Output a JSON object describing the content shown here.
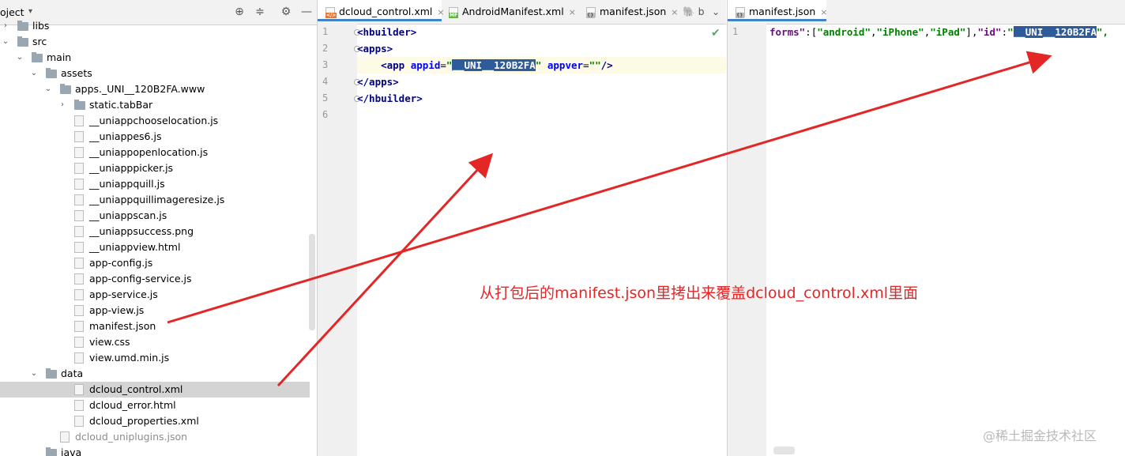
{
  "project": {
    "title": "oject",
    "title_dropdown": "▾",
    "tree": [
      {
        "label": "libs",
        "indent": 1,
        "arrow": "›",
        "kind": "folder"
      },
      {
        "label": "src",
        "indent": 1,
        "arrow": "⌄",
        "kind": "folder"
      },
      {
        "label": "main",
        "indent": 2,
        "arrow": "⌄",
        "kind": "folder"
      },
      {
        "label": "assets",
        "indent": 3,
        "arrow": "⌄",
        "kind": "folder"
      },
      {
        "label": "apps._UNI__120B2FA.www",
        "indent": 4,
        "arrow": "⌄",
        "kind": "folder"
      },
      {
        "label": "static.tabBar",
        "indent": 5,
        "arrow": "›",
        "kind": "folder"
      },
      {
        "label": "__uniappchooselocation.js",
        "indent": 5,
        "kind": "js"
      },
      {
        "label": "__uniappes6.js",
        "indent": 5,
        "kind": "js"
      },
      {
        "label": "__uniappopenlocation.js",
        "indent": 5,
        "kind": "js"
      },
      {
        "label": "__uniapppicker.js",
        "indent": 5,
        "kind": "js"
      },
      {
        "label": "__uniappquill.js",
        "indent": 5,
        "kind": "js"
      },
      {
        "label": "__uniappquillimageresize.js",
        "indent": 5,
        "kind": "js"
      },
      {
        "label": "__uniappscan.js",
        "indent": 5,
        "kind": "js"
      },
      {
        "label": "__uniappsuccess.png",
        "indent": 5,
        "kind": "png"
      },
      {
        "label": "__uniappview.html",
        "indent": 5,
        "kind": "html"
      },
      {
        "label": "app-config.js",
        "indent": 5,
        "kind": "js"
      },
      {
        "label": "app-config-service.js",
        "indent": 5,
        "kind": "js"
      },
      {
        "label": "app-service.js",
        "indent": 5,
        "kind": "js"
      },
      {
        "label": "app-view.js",
        "indent": 5,
        "kind": "js"
      },
      {
        "label": "manifest.json",
        "indent": 5,
        "kind": "json"
      },
      {
        "label": "view.css",
        "indent": 5,
        "kind": "css"
      },
      {
        "label": "view.umd.min.js",
        "indent": 5,
        "kind": "js"
      },
      {
        "label": "data",
        "indent": 3,
        "arrow": "⌄",
        "kind": "folder"
      },
      {
        "label": "dcloud_control.xml",
        "indent": 5,
        "kind": "xml",
        "selected": true
      },
      {
        "label": "dcloud_error.html",
        "indent": 5,
        "kind": "html"
      },
      {
        "label": "dcloud_properties.xml",
        "indent": 5,
        "kind": "xml"
      },
      {
        "label": "dcloud_uniplugins.json",
        "indent": 4,
        "kind": "json",
        "dim": true
      },
      {
        "label": "java",
        "indent": 3,
        "kind": "folder"
      }
    ]
  },
  "editor1": {
    "tabs": [
      {
        "label": "dcloud_control.xml",
        "badge": "</>",
        "active": true,
        "close": "×"
      },
      {
        "label": "AndroidManifest.xml",
        "badge": "MF",
        "active": false,
        "close": "×"
      },
      {
        "label": "manifest.json",
        "badge": "{}",
        "active": false,
        "close": "×"
      },
      {
        "label": "b",
        "badge": "",
        "active": false,
        "close": ""
      }
    ],
    "tab_menu": "⌄",
    "line_numbers": [
      "1",
      "2",
      "3",
      "4",
      "5",
      "6"
    ],
    "code": {
      "l1": "<hbuilder>",
      "l2": "<apps>",
      "l3_indent": "    ",
      "l3_open": "<app ",
      "l3_attr1": "appid",
      "l3_eq1": "=",
      "l3_q1": "\"",
      "l3_value_selected": "__UNI__120B2FA",
      "l3_q2": "\"",
      "l3_attr2": " appver",
      "l3_eq2": "=",
      "l3_value2": "\"\"",
      "l3_close": "/>",
      "l4": "</apps>",
      "l5": "</hbuilder>"
    },
    "checkmark": "✔"
  },
  "editor2": {
    "tab": {
      "label": "manifest.json",
      "badge": "{}",
      "close": "×"
    },
    "line_numbers": [
      "1"
    ],
    "code": {
      "key": "forms",
      "q": "\"",
      "colon": ":",
      "arr_open": "[",
      "v1": "\"android\"",
      "comma": ",",
      "v2": "\"iPhone\"",
      "v3": "\"iPad\"",
      "arr_close": "]",
      "key2": "\"id\"",
      "id_value_selected": "__UNI__120B2FA",
      "tail": "\","
    }
  },
  "annotation": "从打包后的manifest.json里拷出来覆盖dcloud_control.xml里面",
  "watermark": "@稀土掘金技术社区",
  "colors": {
    "arrow": "#e32626",
    "selection": "#2d5b9b",
    "accent_tab": "#4083c9"
  }
}
